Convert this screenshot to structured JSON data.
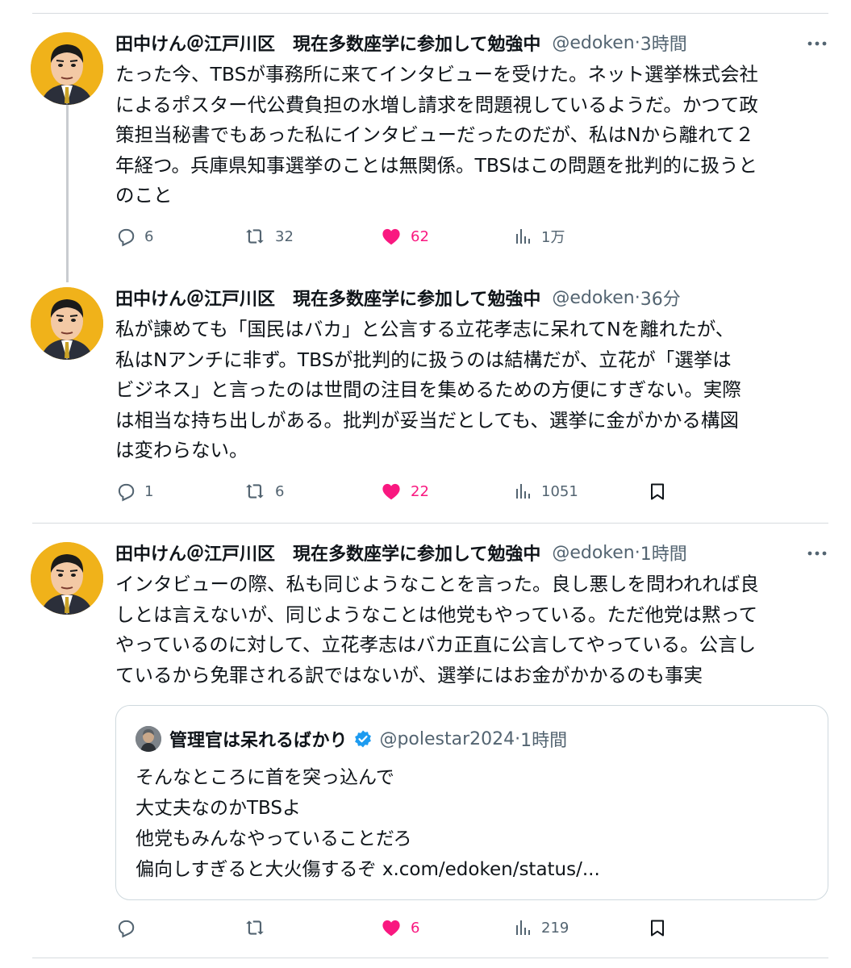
{
  "tweets": [
    {
      "author": "田中けん＠江戸川区　現在多数座学に参加して勉強中",
      "handle": "@edoken",
      "sep": "·",
      "time": "3時間",
      "text": "たった今、TBSが事務所に来てインタビューを受けた。ネット選挙株式会社\nによるポスター代公費負担の水増し請求を問題視しているようだ。かつて政\n策担当秘書でもあった私にインタビューだったのだが、私はNから離れて２\n年経つ。兵庫県知事選挙のことは無関係。TBSはこの問題を批判的に扱うと\nのこと",
      "replies": "6",
      "retweets": "32",
      "likes": "62",
      "views": "1万"
    },
    {
      "author": "田中けん＠江戸川区　現在多数座学に参加して勉強中",
      "handle": "@edoken",
      "sep": "·",
      "time": "36分",
      "text": "私が諫めても「国民はバカ」と公言する立花孝志に呆れてNを離れたが、\n私はNアンチに非ず。TBSが批判的に扱うのは結構だが、立花が「選挙は\nビジネス」と言ったのは世間の注目を集めるための方便にすぎない。実際\nは相当な持ち出しがある。批判が妥当だとしても、選挙に金がかかる構図\nは変わらない。",
      "replies": "1",
      "retweets": "6",
      "likes": "22",
      "views": "1051"
    },
    {
      "author": "田中けん＠江戸川区　現在多数座学に参加して勉強中",
      "handle": "@edoken",
      "sep": "·",
      "time": "1時間",
      "text": "インタビューの際、私も同じようなことを言った。良し悪しを問われれば良\nしとは言えないが、同じようなことは他党もやっている。ただ他党は黙って\nやっているのに対して、立花孝志はバカ正直に公言してやっている。公言し\nているから免罪される訳ではないが、選挙にはお金がかかるのも事実",
      "replies": "",
      "retweets": "",
      "likes": "6",
      "views": "219"
    }
  ],
  "quote": {
    "author": "管理官は呆れるばかり",
    "handle": "@polestar2024",
    "sep": "·",
    "time": "1時間",
    "lines": [
      "そんなところに首を突っ込んで",
      "大丈夫なのかTBSよ",
      "他党もみんなやっていることだろ",
      "偏向しすぎると大火傷するぞ x.com/edoken/status/..."
    ]
  },
  "colors": {
    "like_active": "#f91880",
    "verified": "#1d9bf0",
    "secondary_text": "#536471",
    "avatar_bg": "#f0b21a"
  },
  "icons": {
    "reply": "reply-icon",
    "retweet": "retweet-icon",
    "like": "heart-icon",
    "views": "views-icon",
    "bookmark": "bookmark-icon",
    "more": "more-icon"
  }
}
